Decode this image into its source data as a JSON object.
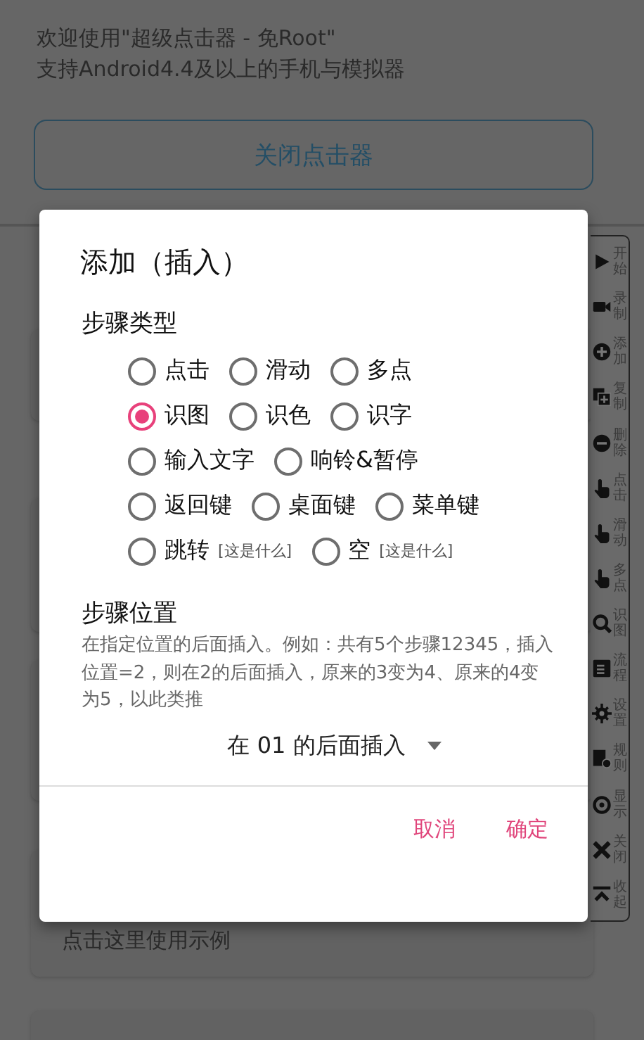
{
  "header": {
    "lines": [
      "欢迎使用\"超级点击器 - 免Root\"",
      "支持Android4.4及以上的手机与模拟器"
    ]
  },
  "close_button": "关闭点击器",
  "example_card": {
    "text": "点击这里使用示例"
  },
  "toolbar": {
    "items": [
      {
        "label": "开始"
      },
      {
        "label": "录制"
      },
      {
        "label": "添加"
      },
      {
        "label": "复制"
      },
      {
        "label": "删除"
      },
      {
        "label": "点击"
      },
      {
        "label": "滑动"
      },
      {
        "label": "多点"
      },
      {
        "label": "识图"
      },
      {
        "label": "流程"
      },
      {
        "label": "设置"
      },
      {
        "label": "规则"
      },
      {
        "label": "显示"
      },
      {
        "label": "关闭"
      },
      {
        "label": "收起"
      }
    ]
  },
  "dialog": {
    "title": "添加（插入）",
    "type_heading": "步骤类型",
    "type_rows": [
      [
        {
          "label": "点击",
          "selected": false
        },
        {
          "label": "滑动",
          "selected": false
        },
        {
          "label": "多点",
          "selected": false
        }
      ],
      [
        {
          "label": "识图",
          "selected": true
        },
        {
          "label": "识色",
          "selected": false
        },
        {
          "label": "识字",
          "selected": false
        }
      ],
      [
        {
          "label": "输入文字",
          "selected": false
        },
        {
          "label": "响铃&暂停",
          "selected": false
        }
      ],
      [
        {
          "label": "返回键",
          "selected": false
        },
        {
          "label": "桌面键",
          "selected": false
        },
        {
          "label": "菜单键",
          "selected": false
        }
      ],
      [
        {
          "label": "跳转",
          "selected": false,
          "hint": "[这是什么]"
        },
        {
          "label": "空",
          "selected": false,
          "hint": "[这是什么]"
        }
      ]
    ],
    "position_heading": "步骤位置",
    "position_description": "在指定位置的后面插入。例如：共有5个步骤12345，插入位置=2，则在2的后面插入，原来的3变为4、原来的4变为5，以此类推",
    "position_select": "在 01 的后面插入",
    "buttons": [
      "取消",
      "确定"
    ]
  }
}
